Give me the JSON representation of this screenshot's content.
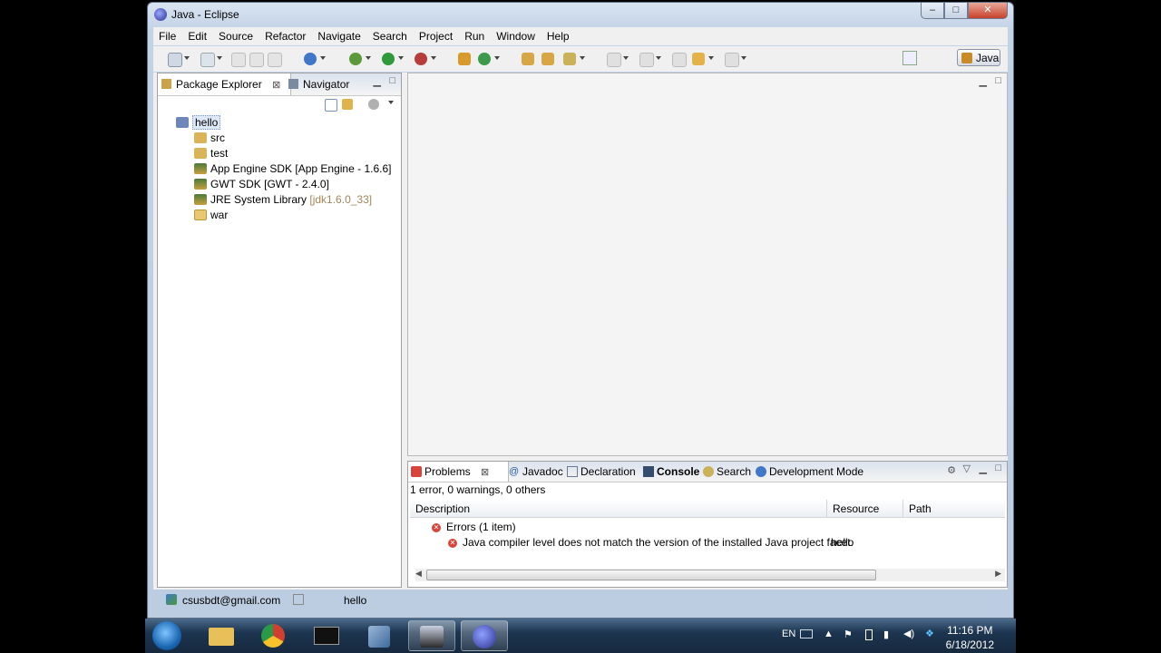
{
  "window": {
    "title": "Java - Eclipse"
  },
  "menu": [
    "File",
    "Edit",
    "Source",
    "Refactor",
    "Navigate",
    "Search",
    "Project",
    "Run",
    "Window",
    "Help"
  ],
  "perspective": {
    "label": "Java"
  },
  "left_view": {
    "tabs": [
      {
        "label": "Package Explorer",
        "active": true
      },
      {
        "label": "Navigator",
        "active": false
      }
    ],
    "tree": {
      "project": "hello",
      "children": [
        {
          "label": "src",
          "icon": "package-folder-icon"
        },
        {
          "label": "test",
          "icon": "package-folder-icon"
        },
        {
          "label": "App Engine SDK [App Engine - 1.6.6]",
          "icon": "library-icon"
        },
        {
          "label": "GWT SDK [GWT - 2.4.0]",
          "icon": "library-icon"
        },
        {
          "label": "JRE System Library",
          "suffix": "[jdk1.6.0_33]",
          "icon": "library-icon"
        },
        {
          "label": "war",
          "icon": "folder-icon"
        }
      ]
    }
  },
  "bottom_panel": {
    "tabs": [
      {
        "label": "Problems",
        "active": true
      },
      {
        "label": "Javadoc"
      },
      {
        "label": "Declaration"
      },
      {
        "label": "Console",
        "bold": true
      },
      {
        "label": "Search"
      },
      {
        "label": "Development Mode"
      }
    ],
    "summary": "1 error, 0 warnings, 0 others",
    "columns": [
      "Description",
      "Resource",
      "Path"
    ],
    "group": "Errors (1 item)",
    "error": {
      "description": "Java compiler level does not match the version of the installed Java project facet.",
      "resource": "hello",
      "path": ""
    }
  },
  "status": {
    "user": "csusbdt@gmail.com",
    "selection": "hello"
  },
  "taskbar": {
    "lang": "EN",
    "time": "11:16 PM",
    "date": "6/18/2012"
  },
  "colors": {
    "error": "#d9443a",
    "selection": "#dde8f8"
  }
}
